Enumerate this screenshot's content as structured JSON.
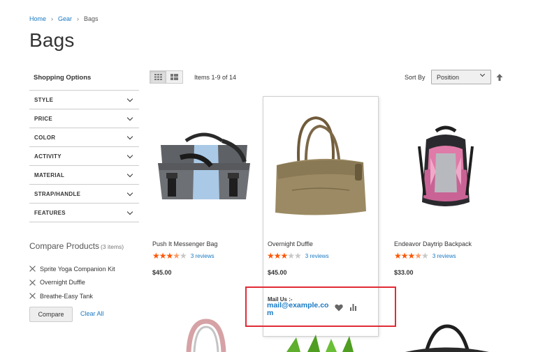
{
  "breadcrumb": [
    "Home",
    "Gear",
    "Bags"
  ],
  "page_title": "Bags",
  "sidebar": {
    "title": "Shopping Options",
    "filters": [
      "STYLE",
      "PRICE",
      "COLOR",
      "ACTIVITY",
      "MATERIAL",
      "STRAP/HANDLE",
      "FEATURES"
    ]
  },
  "compare": {
    "title": "Compare Products",
    "count": "(3 items)",
    "items": [
      "Sprite Yoga Companion Kit",
      "Overnight Duffle",
      "Breathe-Easy Tank"
    ],
    "button": "Compare",
    "clear": "Clear All"
  },
  "toolbar": {
    "items_text": "Items 1-9 of 14",
    "sort_label": "Sort By",
    "sort_value": "Position",
    "view_modes": [
      "grid-icon",
      "list-icon"
    ],
    "sort_direction_icon": "arrow-up-icon"
  },
  "products": [
    {
      "name": "Push It Messenger Bag",
      "rating": 3.5,
      "reviews": "3 reviews",
      "price": "$45.00"
    },
    {
      "name": "Overnight Duffle",
      "rating": 3,
      "reviews": "3 reviews",
      "price": "$45.00"
    },
    {
      "name": "Endeavor Daytrip Backpack",
      "rating": 3.5,
      "reviews": "3 reviews",
      "price": "$33.00"
    }
  ],
  "hover_actions": {
    "mail_label": "Mail Us :-",
    "mail_address": "mail@example.com",
    "icons": [
      "heart-icon",
      "bar-chart-icon"
    ]
  },
  "colors": {
    "link": "#1979c3",
    "star": "#ff5501",
    "highlight": "#e02b35"
  }
}
